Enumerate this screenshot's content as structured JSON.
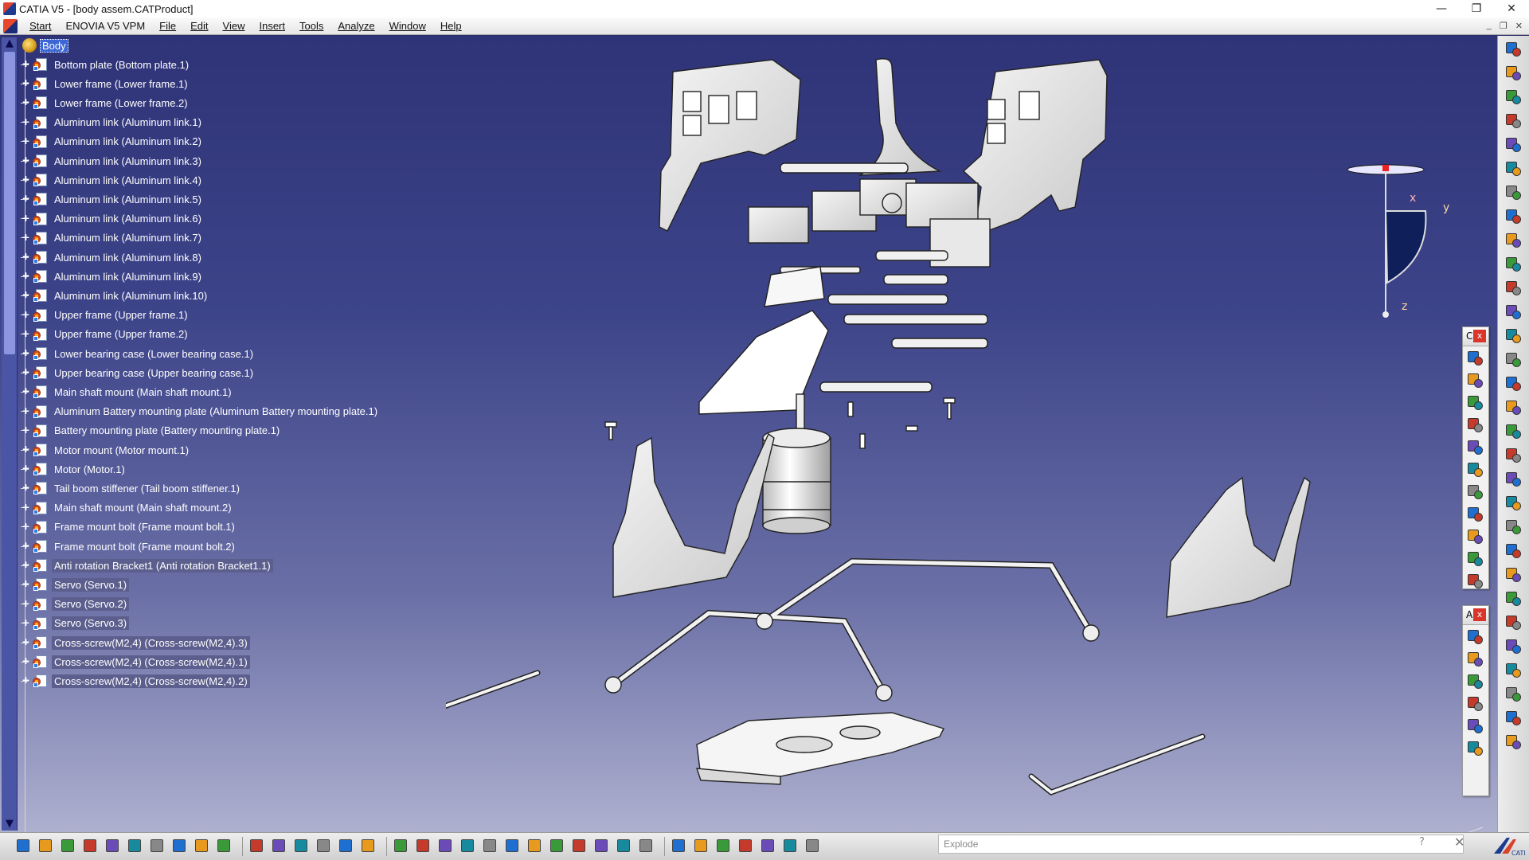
{
  "window": {
    "title": "CATIA V5 - [body assem.CATProduct]",
    "minimize": "—",
    "restore": "❐",
    "close": "✕"
  },
  "menu": {
    "items": [
      {
        "label": "Start",
        "underline": true
      },
      {
        "label": "ENOVIA V5 VPM",
        "underline": false
      },
      {
        "label": "File",
        "underline": true
      },
      {
        "label": "Edit",
        "underline": true
      },
      {
        "label": "View",
        "underline": true
      },
      {
        "label": "Insert",
        "underline": true
      },
      {
        "label": "Tools",
        "underline": true
      },
      {
        "label": "Analyze",
        "underline": true
      },
      {
        "label": "Window",
        "underline": true
      },
      {
        "label": "Help",
        "underline": true
      }
    ],
    "mdi_buttons": [
      "_",
      "❐",
      "✕"
    ]
  },
  "tree": {
    "root": "Body",
    "nodes": [
      {
        "label": "Bottom plate (Bottom plate.1)",
        "selected": false
      },
      {
        "label": "Lower frame (Lower frame.1)",
        "selected": false
      },
      {
        "label": "Lower frame (Lower frame.2)",
        "selected": false
      },
      {
        "label": "Aluminum link (Aluminum link.1)",
        "selected": false
      },
      {
        "label": "Aluminum link (Aluminum link.2)",
        "selected": false
      },
      {
        "label": "Aluminum link (Aluminum link.3)",
        "selected": false
      },
      {
        "label": "Aluminum link (Aluminum link.4)",
        "selected": false
      },
      {
        "label": "Aluminum link (Aluminum link.5)",
        "selected": false
      },
      {
        "label": "Aluminum link (Aluminum link.6)",
        "selected": false
      },
      {
        "label": "Aluminum link (Aluminum link.7)",
        "selected": false
      },
      {
        "label": "Aluminum link (Aluminum link.8)",
        "selected": false
      },
      {
        "label": "Aluminum link (Aluminum link.9)",
        "selected": false
      },
      {
        "label": "Aluminum link (Aluminum link.10)",
        "selected": false
      },
      {
        "label": "Upper frame (Upper frame.1)",
        "selected": false
      },
      {
        "label": "Upper frame (Upper frame.2)",
        "selected": false
      },
      {
        "label": "Lower bearing case (Lower bearing case.1)",
        "selected": false
      },
      {
        "label": "Upper bearing case (Upper bearing case.1)",
        "selected": false
      },
      {
        "label": "Main shaft mount (Main shaft mount.1)",
        "selected": false
      },
      {
        "label": "Aluminum Battery mounting plate (Aluminum Battery mounting plate.1)",
        "selected": false
      },
      {
        "label": "Battery mounting plate (Battery mounting plate.1)",
        "selected": false
      },
      {
        "label": "Motor mount (Motor mount.1)",
        "selected": false
      },
      {
        "label": "Motor (Motor.1)",
        "selected": false
      },
      {
        "label": "Tail boom stiffener (Tail boom stiffener.1)",
        "selected": false
      },
      {
        "label": "Main shaft mount (Main shaft mount.2)",
        "selected": false
      },
      {
        "label": "Frame mount bolt (Frame mount bolt.1)",
        "selected": false
      },
      {
        "label": "Frame mount bolt (Frame mount bolt.2)",
        "selected": false
      },
      {
        "label": "Anti rotation Bracket1 (Anti rotation Bracket1.1)",
        "selected": true
      },
      {
        "label": "Servo (Servo.1)",
        "selected": true
      },
      {
        "label": "Servo (Servo.2)",
        "selected": true
      },
      {
        "label": "Servo (Servo.3)",
        "selected": true
      },
      {
        "label": "Cross-screw(M2,4) (Cross-screw(M2,4).3)",
        "selected": true
      },
      {
        "label": "Cross-screw(M2,4) (Cross-screw(M2,4).1)",
        "selected": true
      },
      {
        "label": "Cross-screw(M2,4) (Cross-screw(M2,4).2)",
        "selected": true
      }
    ]
  },
  "compass": {
    "axis_x": "x",
    "axis_y": "y",
    "axis_z": "z"
  },
  "float_toolbars": [
    {
      "header": "C",
      "close": "x"
    },
    {
      "header": "A",
      "close": "x"
    }
  ],
  "status": {
    "placeholder": "Explode",
    "help": "?",
    "close": "✕"
  },
  "colors": {
    "selection": "#5c5f8d",
    "root_highlight": "#3c66d6",
    "viewport_top": "#2f3377",
    "viewport_bottom": "#aeb0cf"
  }
}
